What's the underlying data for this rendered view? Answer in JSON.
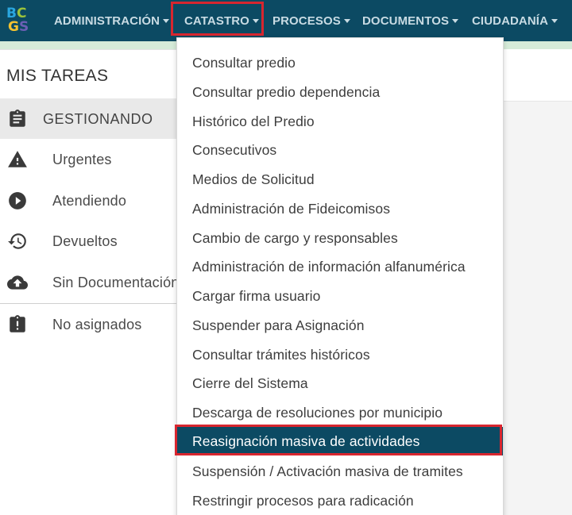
{
  "app": {
    "logo": {
      "line1a": "B",
      "line1b": "C",
      "line2a": "G",
      "line2b": "S"
    }
  },
  "navbar": {
    "items": [
      {
        "label": "ADMINISTRACIÓN"
      },
      {
        "label": "CATASTRO",
        "highlighted": true
      },
      {
        "label": "PROCESOS"
      },
      {
        "label": "DOCUMENTOS"
      },
      {
        "label": "CIUDADANÍA"
      }
    ]
  },
  "sidebar": {
    "title": "MIS TAREAS",
    "header": {
      "label": "GESTIONANDO",
      "icon": "clipboard-icon"
    },
    "items": [
      {
        "label": "Urgentes",
        "icon": "warning-icon"
      },
      {
        "label": "Atendiendo",
        "icon": "play-circle-icon"
      },
      {
        "label": "Devueltos",
        "icon": "history-icon"
      },
      {
        "label": "Sin Documentación",
        "icon": "cloud-upload-icon"
      },
      {
        "label": "No asignados",
        "icon": "clipboard-alert-icon"
      }
    ]
  },
  "dropdown": {
    "items": [
      {
        "label": "Consultar predio"
      },
      {
        "label": "Consultar predio dependencia"
      },
      {
        "label": "Histórico del Predio"
      },
      {
        "label": "Consecutivos"
      },
      {
        "label": "Medios de Solicitud"
      },
      {
        "label": "Administración de Fideicomisos"
      },
      {
        "label": "Cambio de cargo y responsables"
      },
      {
        "label": "Administración de información alfanumérica"
      },
      {
        "label": "Cargar firma usuario"
      },
      {
        "label": "Suspender para Asignación"
      },
      {
        "label": "Consultar trámites históricos"
      },
      {
        "label": "Cierre del Sistema"
      },
      {
        "label": "Descarga de resoluciones por municipio"
      },
      {
        "label": "Reasignación masiva de actividades",
        "selected": true
      },
      {
        "label": "Suspensión / Activación masiva de tramites"
      },
      {
        "label": "Restringir procesos para radicación"
      }
    ]
  },
  "colors": {
    "navbar_bg": "#0c4a63",
    "highlight_red": "#d8262f",
    "selected_bg": "#0c4a63"
  }
}
